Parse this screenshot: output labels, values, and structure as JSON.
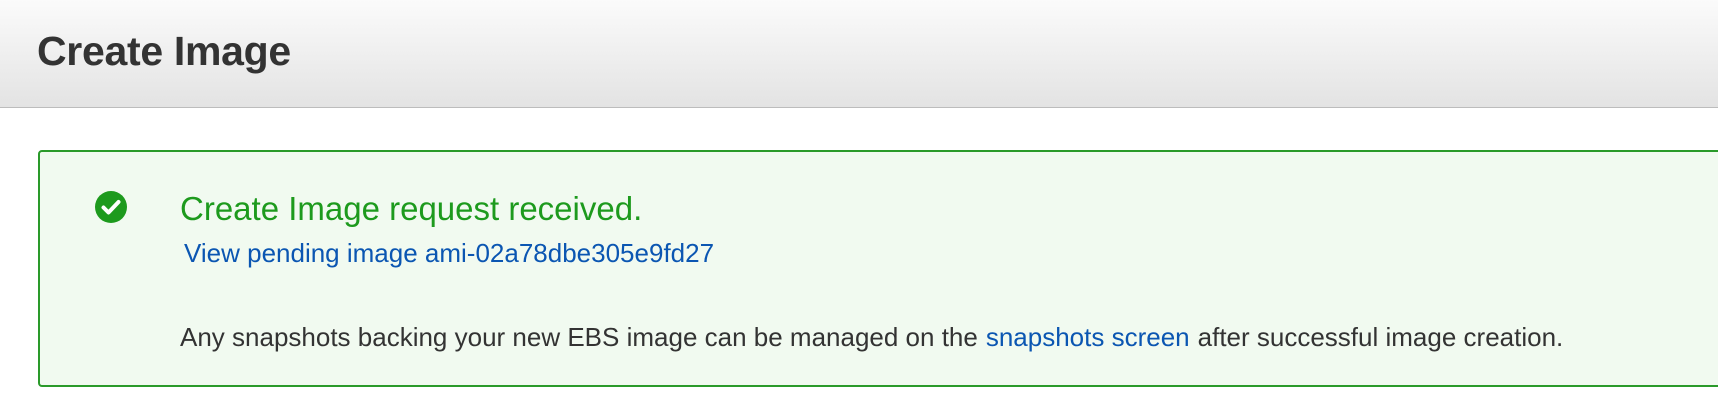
{
  "header": {
    "title": "Create Image"
  },
  "alert": {
    "title": "Create Image request received.",
    "pending_link_prefix": "View pending image ",
    "pending_image_id": "ami-02a78dbe305e9fd27",
    "message_before": "Any snapshots backing your new EBS image can be managed on the",
    "snapshots_link": "snapshots screen",
    "message_after": "after successful image creation.",
    "icon": "check-circle-icon",
    "status": "success",
    "accent_color": "#1d9a1d",
    "link_color": "#0b56b2"
  }
}
